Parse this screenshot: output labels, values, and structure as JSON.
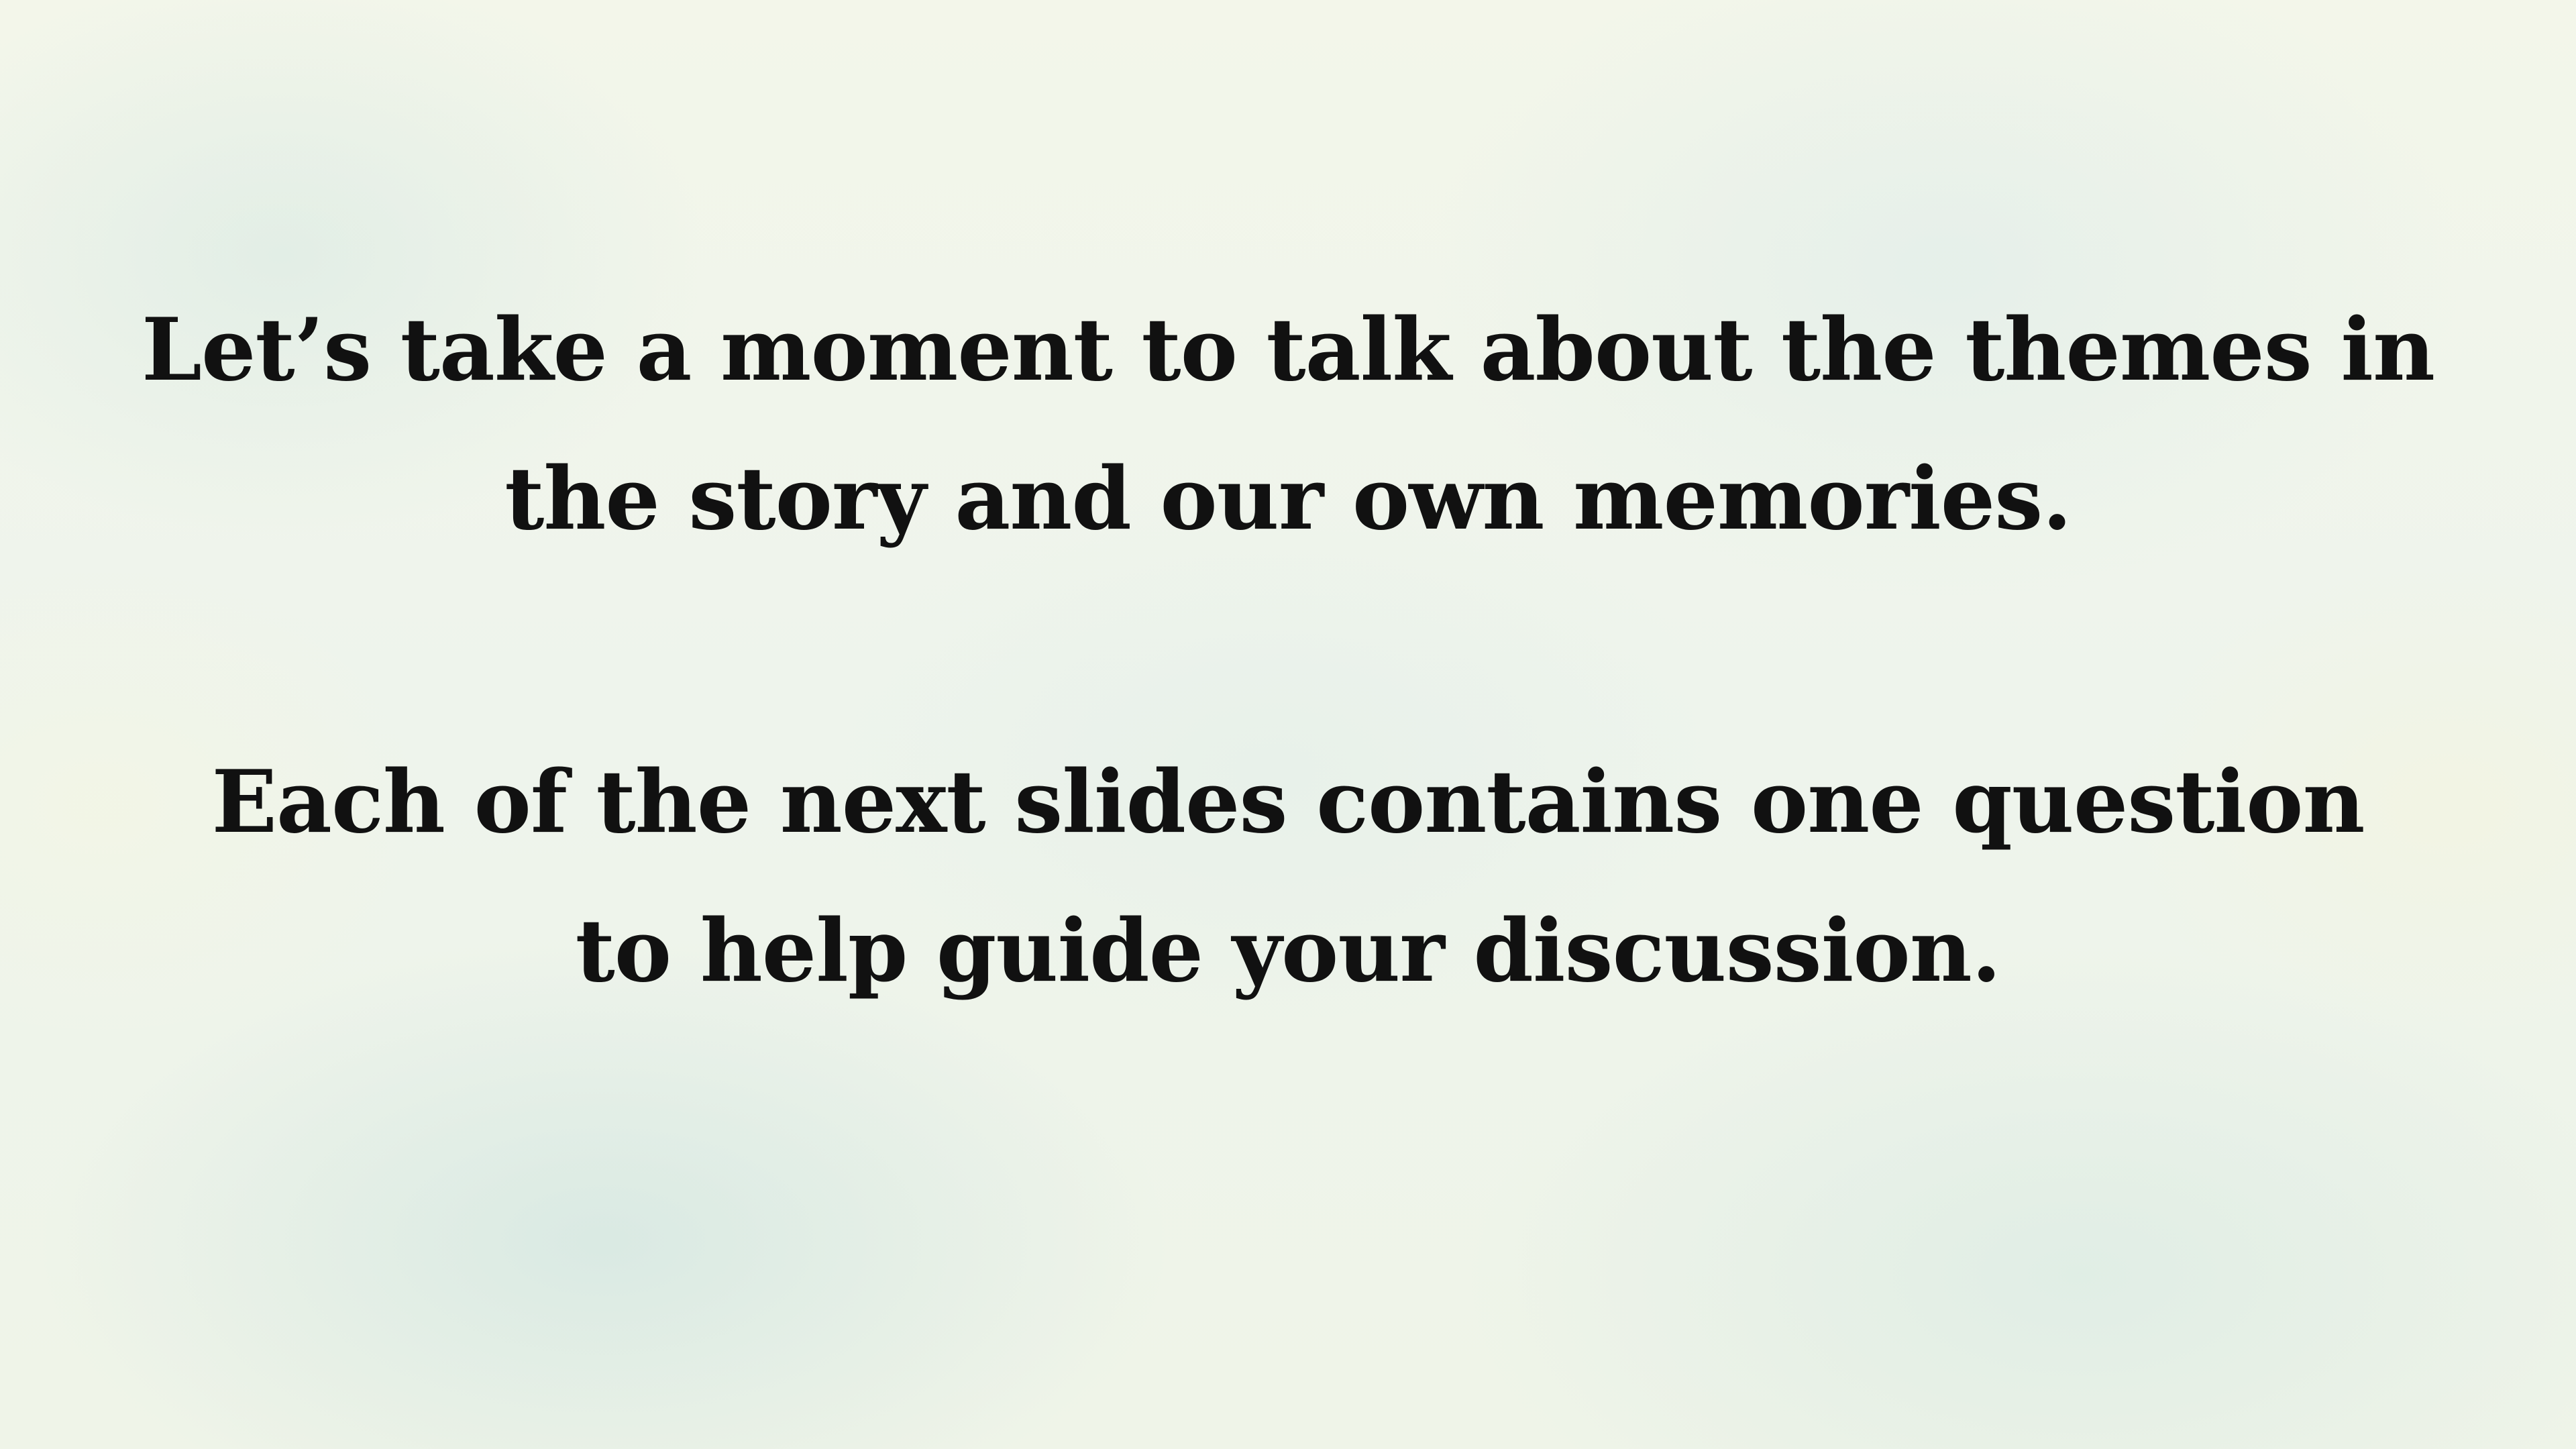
{
  "slide": {
    "paragraphs": [
      {
        "lines": [
          "Let’s take a moment to talk about the themes in",
          "the story and our own memories."
        ]
      },
      {
        "lines": [
          "Each of the next slides contains one question",
          "to help guide your discussion."
        ]
      }
    ]
  },
  "colors": {
    "background": "#f1f5ea",
    "text": "#111111"
  }
}
